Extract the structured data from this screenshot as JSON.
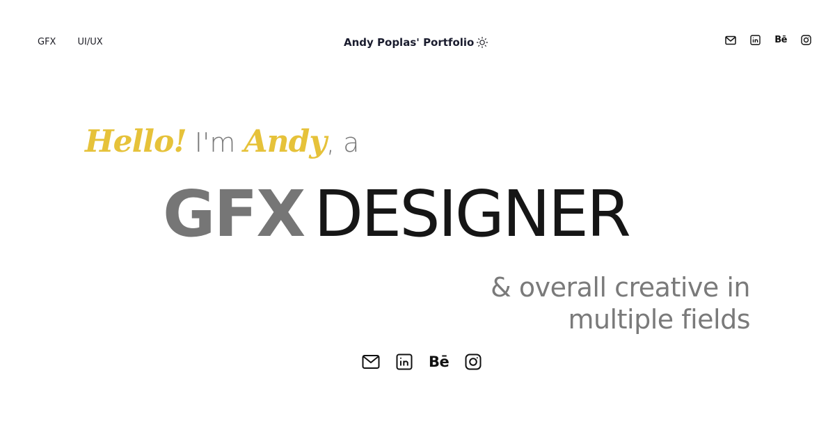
{
  "nav": {
    "links": [
      "GFX",
      "UI/UX"
    ]
  },
  "header": {
    "title": "Andy Poplas' Portfolio",
    "theme_icon": "sun-icon"
  },
  "social": {
    "icons": [
      "mail-icon",
      "linkedin-icon",
      "behance-icon",
      "instagram-icon"
    ],
    "behance_label": "Bē"
  },
  "hero": {
    "greeting_hello": "Hello!",
    "greeting_im": " I'm ",
    "greeting_name": "Andy",
    "greeting_tail": ", a",
    "title_part1": "GFX",
    "title_part2": "DESIGNER",
    "subtitle_line1": "& overall creative in",
    "subtitle_line2": "multiple fields"
  },
  "colors": {
    "accent": "#e6c23a",
    "muted_text": "#7a7a7a",
    "dark_text": "#161616",
    "background": "#ffffff"
  }
}
